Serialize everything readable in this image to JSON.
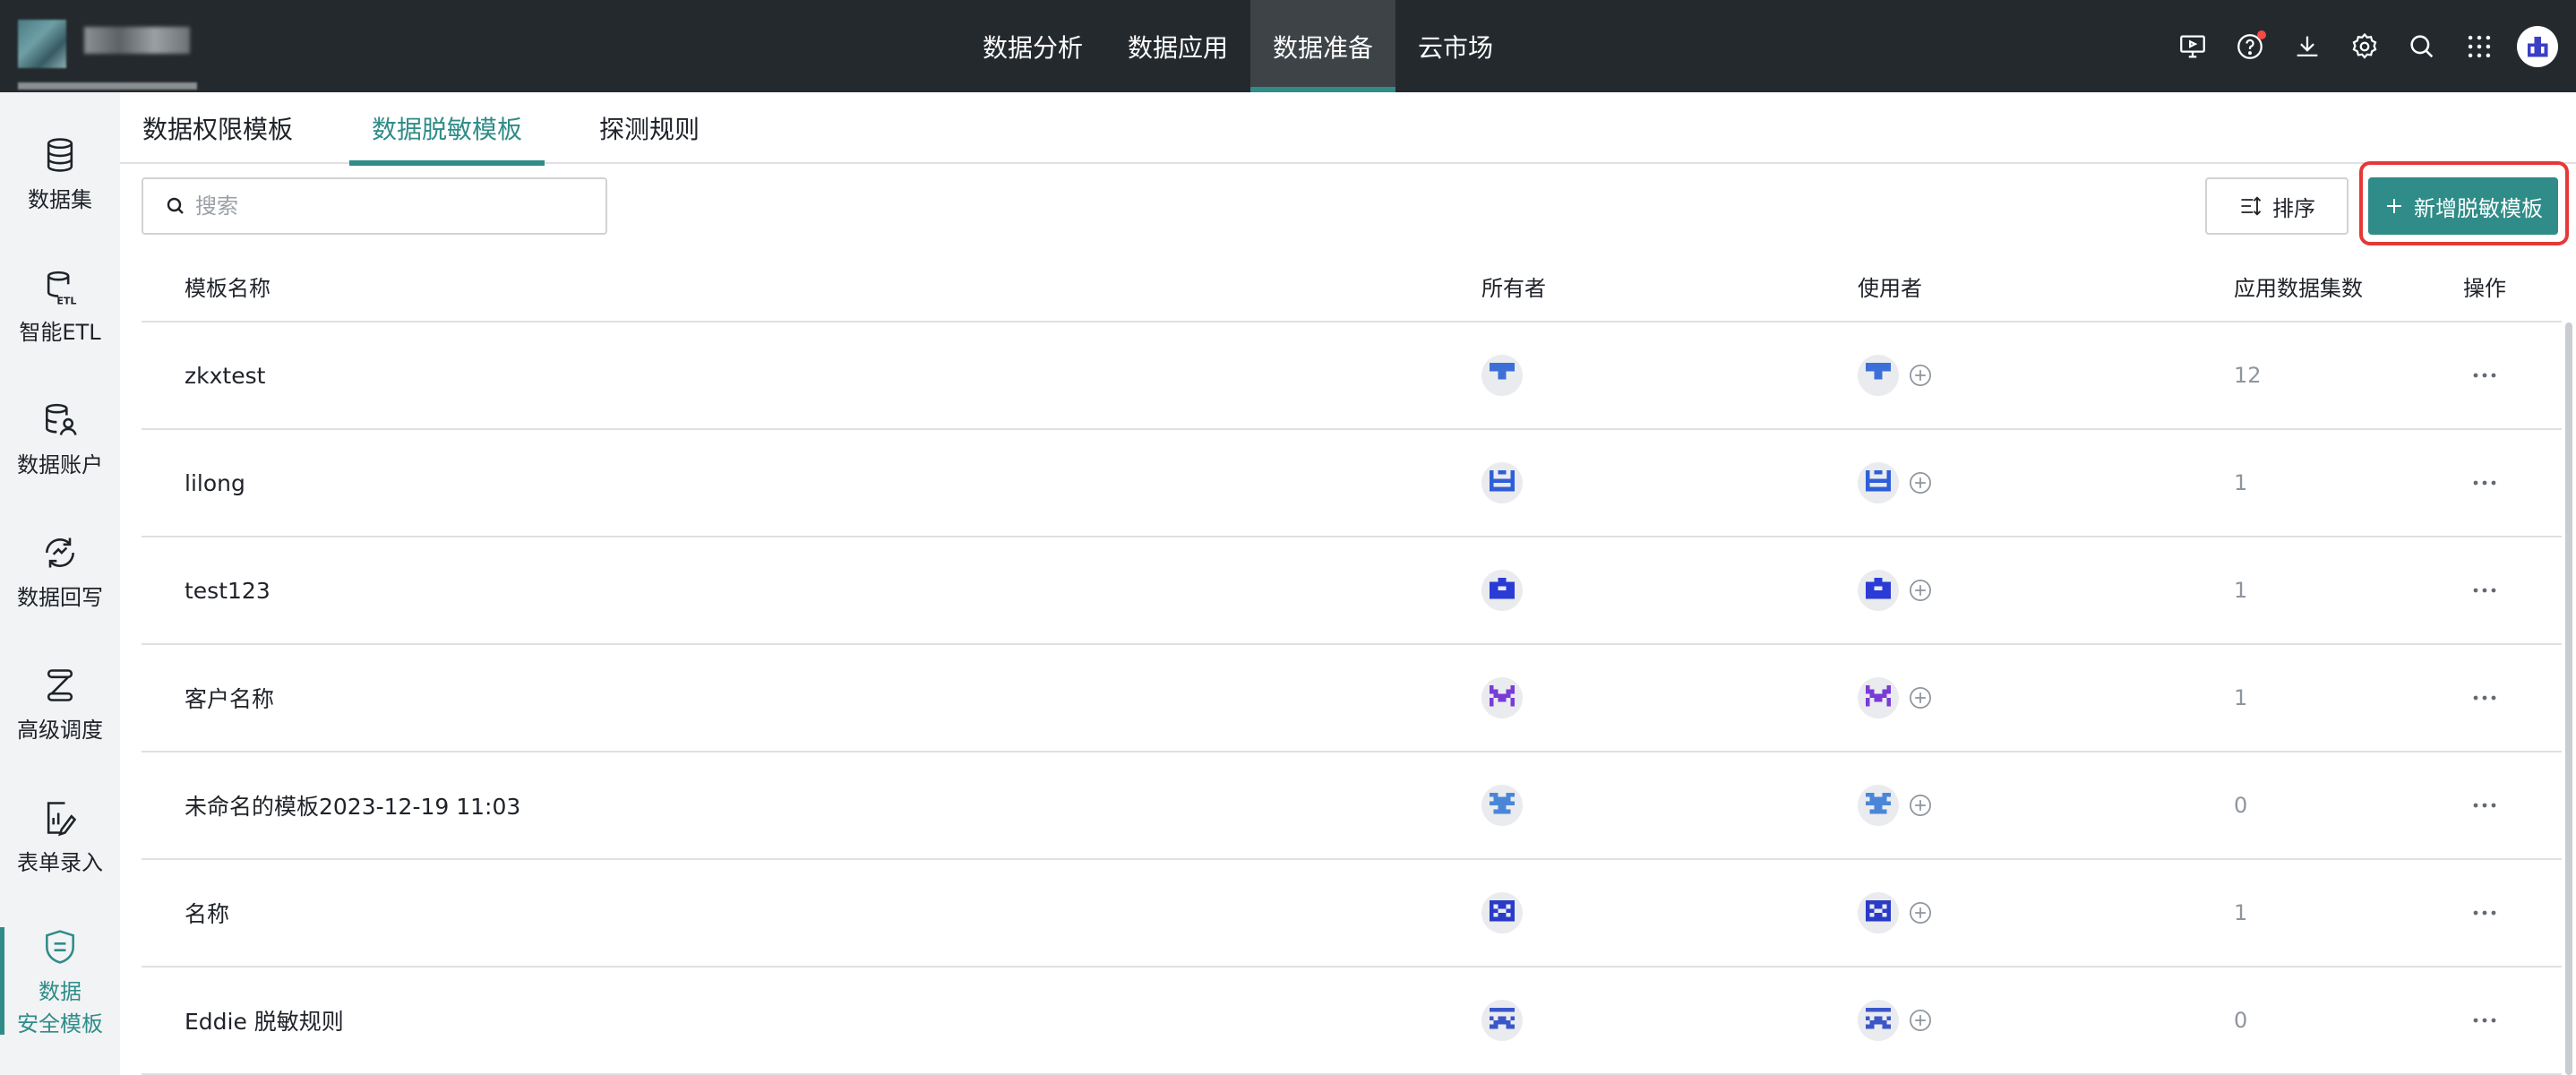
{
  "top_nav": {
    "items": [
      {
        "label": "数据分析",
        "active": false
      },
      {
        "label": "数据应用",
        "active": false
      },
      {
        "label": "数据准备",
        "active": true
      },
      {
        "label": "云市场",
        "active": false
      }
    ],
    "accent": "#2f8c88"
  },
  "toolbar_icons": [
    "monitor-icon",
    "help-icon",
    "download-icon",
    "settings-icon",
    "search-icon",
    "apps-grid-icon",
    "user-avatar"
  ],
  "sidebar": {
    "items": [
      {
        "label": "数据集",
        "icon": "database-icon"
      },
      {
        "label": "智能ETL",
        "icon": "etl-icon"
      },
      {
        "label": "数据账户",
        "icon": "data-account-icon"
      },
      {
        "label": "数据回写",
        "icon": "data-writeback-icon"
      },
      {
        "label": "高级调度",
        "icon": "schedule-icon"
      },
      {
        "label": "表单录入",
        "icon": "form-entry-icon"
      },
      {
        "label_line1": "数据",
        "label_line2": "安全模板",
        "icon": "shield-icon",
        "active": true
      }
    ]
  },
  "tabs": [
    {
      "label": "数据权限模板",
      "active": false
    },
    {
      "label": "数据脱敏模板",
      "active": true
    },
    {
      "label": "探测规则",
      "active": false
    }
  ],
  "search": {
    "placeholder": "搜索",
    "value": ""
  },
  "sort_label": "排序",
  "add_label": "新增脱敏模板",
  "table": {
    "headers": {
      "name": "模板名称",
      "owner": "所有者",
      "user": "使用者",
      "count": "应用数据集数",
      "op": "操作"
    },
    "rows": [
      {
        "name": "zkxtest",
        "count": "12",
        "avatar_color": "#3d6fd8"
      },
      {
        "name": "lilong",
        "count": "1",
        "avatar_color": "#2f5fd8"
      },
      {
        "name": "test123",
        "count": "1",
        "avatar_color": "#2a3bd6"
      },
      {
        "name": "客户名称",
        "count": "1",
        "avatar_color": "#7a3bd6"
      },
      {
        "name": "未命名的模板2023-12-19 11:03",
        "count": "0",
        "avatar_color": "#4a86d8"
      },
      {
        "name": "名称",
        "count": "1",
        "avatar_color": "#2a3bc8"
      },
      {
        "name": "Eddie 脱敏规则",
        "count": "0",
        "avatar_color": "#3a56c8"
      }
    ]
  }
}
